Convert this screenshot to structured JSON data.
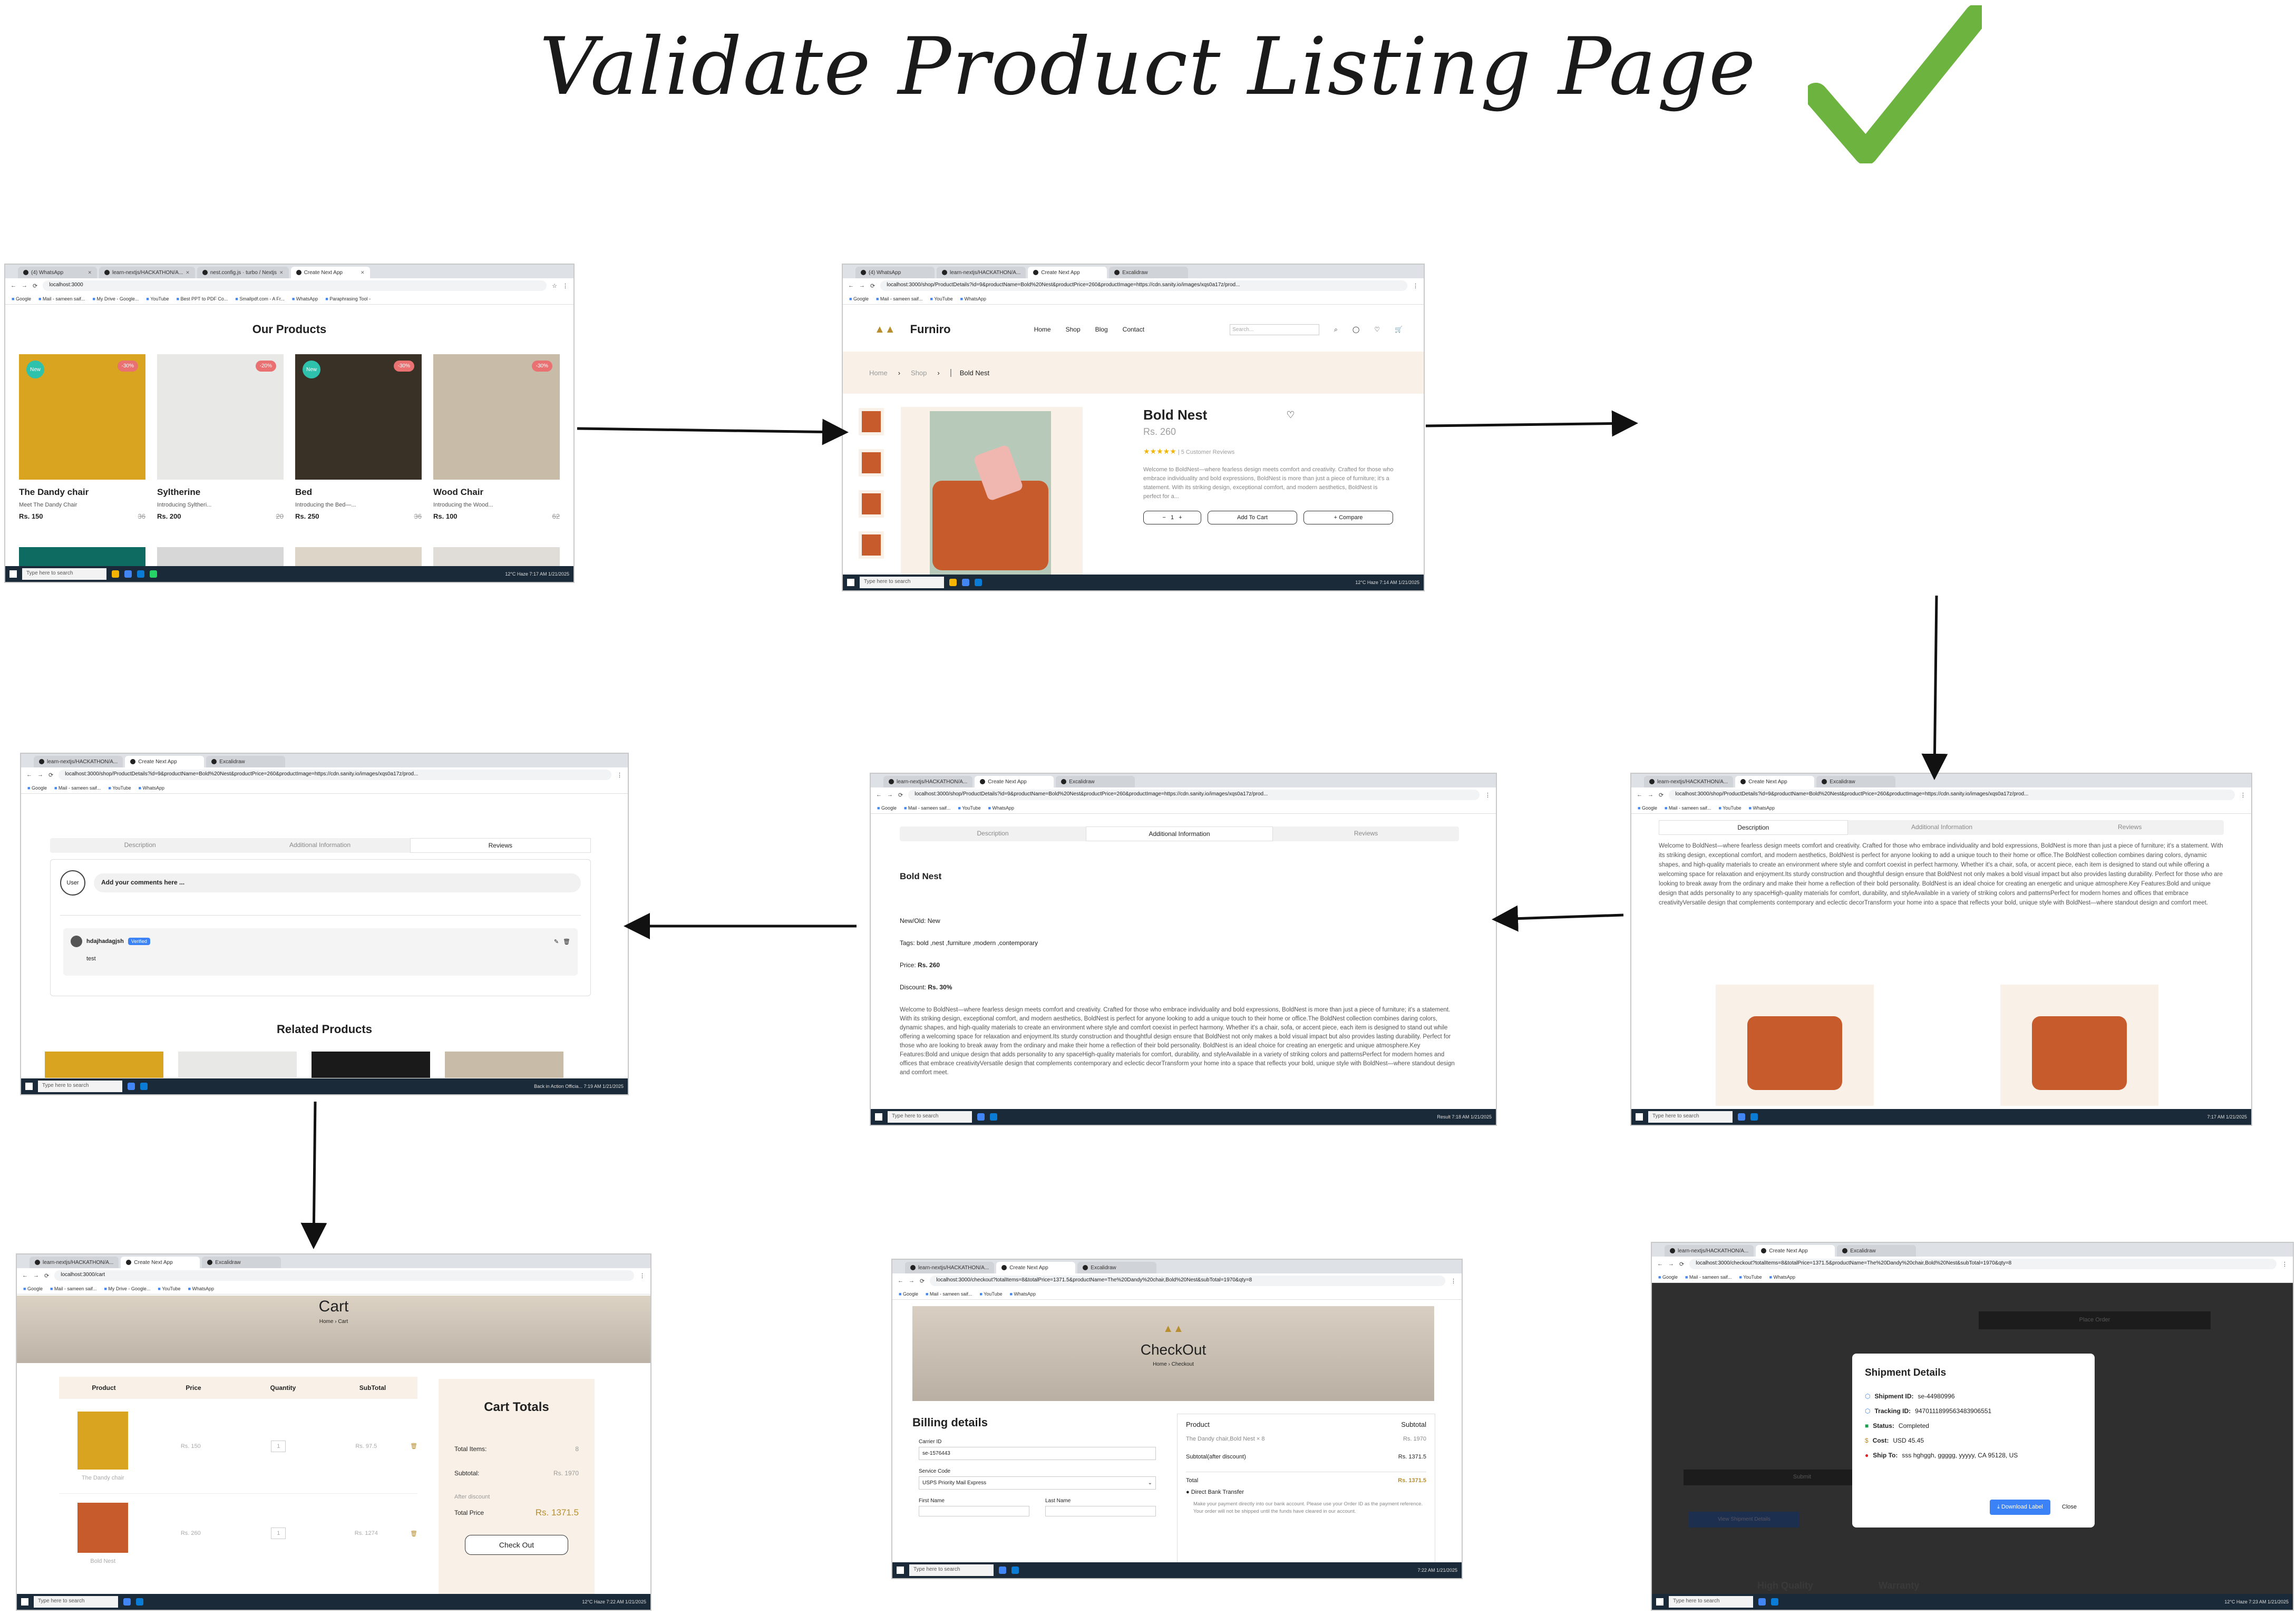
{
  "title": "Validate Product Listing Page",
  "colors": {
    "check": "#6cb33f",
    "gold": "#b88e2f",
    "beige": "#f9f1e7",
    "sofa": "#c75b2c",
    "badge_new": "#2ec1ac",
    "badge_sale": "#e97171",
    "taskbar": "#1b2a38"
  },
  "shot1": {
    "tabs": [
      "(4) WhatsApp",
      "learn-nextjs/HACKATHON/A...",
      "nest.config.js · turbo / Nextjs",
      "Create Next App"
    ],
    "url": "localhost:3000",
    "bookmarks": [
      "Google",
      "Mail - sameen saif...",
      "My Drive - Google...",
      "YouTube",
      "Best PPT to PDF Co...",
      "Smallpdf.com - A Fr...",
      "WhatsApp",
      "Paraphrasing Tool -",
      "All Bookmarks"
    ],
    "heading": "Our Products",
    "products": [
      {
        "name": "The Dandy chair",
        "desc": "Meet The Dandy Chair",
        "price": "Rs. 150",
        "old": "36",
        "badge": "New",
        "badge2": "-30%",
        "color": "#d9a521"
      },
      {
        "name": "Syltherine",
        "desc": "Introducing Syltheri...",
        "price": "Rs. 200",
        "old": "20",
        "badge": "",
        "badge2": "-20%",
        "color": "#e8e8e6"
      },
      {
        "name": "Bed",
        "desc": "Introducing the Bed—...",
        "price": "Rs. 250",
        "old": "36",
        "badge": "New",
        "badge2": "-30%",
        "color": "#3a3126"
      },
      {
        "name": "Wood Chair",
        "desc": "Introducing the Wood...",
        "price": "Rs. 100",
        "old": "62",
        "badge": "",
        "badge2": "-30%",
        "color": "#c8bca8"
      }
    ],
    "taskbar": {
      "search": "Type here to search",
      "tray": "12°C Haze  7:17 AM 1/21/2025"
    }
  },
  "shot2": {
    "tabs": [
      "(4) WhatsApp",
      "learn-nextjs/HACKATHON/A...",
      "Create Next App",
      "Excalidraw"
    ],
    "url": "localhost:3000/shop/ProductDetails?id=9&productName=Bold%20Nest&productPrice=260&productImage=https://cdn.sanity.io/images/xqs0a17z/prod...",
    "brand": "Furniro",
    "nav": [
      "Home",
      "Shop",
      "Blog",
      "Contact"
    ],
    "search": "Search...",
    "crumbs": [
      "Home",
      "Shop",
      "Bold Nest"
    ],
    "name": "Bold Nest",
    "price": "Rs. 260",
    "reviews": "5 Customer Reviews",
    "desc": "Welcome to BoldNest—where fearless design meets comfort and creativity. Crafted for those who embrace individuality and bold expressions, BoldNest is more than just a piece of furniture; it's a statement. With its striking design, exceptional comfort, and modern aesthetics, BoldNest is perfect for a...",
    "qty": "1",
    "add": "Add To Cart",
    "compare": "+ Compare",
    "taskbar": {
      "search": "Type here to search",
      "tray": "12°C Haze  7:14 AM 1/21/2025"
    }
  },
  "shot3": {
    "tabs": [
      "learn-nextjs/HACKATHON/A...",
      "Create Next App",
      "Excalidraw"
    ],
    "url": "localhost:3000/shop/ProductDetails?id=9&productName=Bold%20Nest&productPrice=260&productImage=https://cdn.sanity.io/images/xqs0a17z/prod...",
    "tabs_inner": [
      "Description",
      "Additional Information",
      "Reviews"
    ],
    "text": "Welcome to BoldNest—where fearless design meets comfort and creativity. Crafted for those who embrace individuality and bold expressions, BoldNest is more than just a piece of furniture; it's a statement. With its striking design, exceptional comfort, and modern aesthetics, BoldNest is perfect for anyone looking to add a unique touch to their home or office.The BoldNest collection combines daring colors, dynamic shapes, and high-quality materials to create an environment where style and comfort coexist in perfect harmony. Whether it's a chair, sofa, or accent piece, each item is designed to stand out while offering a welcoming space for relaxation and enjoyment.Its sturdy construction and thoughtful design ensure that BoldNest not only makes a bold visual impact but also provides lasting durability. Perfect for those who are looking to break away from the ordinary and make their home a reflection of their bold personality. BoldNest is an ideal choice for creating an energetic and unique atmosphere.Key Features:Bold and unique design that adds personality to any spaceHigh-quality materials for comfort, durability, and styleAvailable in a variety of striking colors and patternsPerfect for modern homes and offices that embrace creativityVersatile design that complements contemporary and eclectic decorTransform your home into a space that reflects your bold, unique style with BoldNest—where standout design and comfort meet.",
    "taskbar": {
      "search": "Type here to search",
      "tray": "7:17 AM 1/21/2025"
    }
  },
  "shot4": {
    "tabs": [
      "learn-nextjs/HACKATHON/A...",
      "Create Next App",
      "Excalidraw"
    ],
    "url": "localhost:3000/shop/ProductDetails?id=9&productName=Bold%20Nest&productPrice=260&productImage=https://cdn.sanity.io/images/xqs0a17z/prod...",
    "tabs_inner": [
      "Description",
      "Additional Information",
      "Reviews"
    ],
    "name": "Bold Nest",
    "new_label": "New/Old:",
    "new_val": "New",
    "tags_label": "Tags:",
    "tags_val": "bold ,nest ,furniture ,modern ,contemporary",
    "price_label": "Price:",
    "price_val": "Rs. 260",
    "disc_label": "Discount:",
    "disc_val": "Rs. 30%",
    "text": "Welcome to BoldNest—where fearless design meets comfort and creativity. Crafted for those who embrace individuality and bold expressions, BoldNest is more than just a piece of furniture; it's a statement. With its striking design, exceptional comfort, and modern aesthetics, BoldNest is perfect for anyone looking to add a unique touch to their home or office.The BoldNest collection combines daring colors, dynamic shapes, and high-quality materials to create an environment where style and comfort coexist in perfect harmony. Whether it's a chair, sofa, or accent piece, each item is designed to stand out while offering a welcoming space for relaxation and enjoyment.Its sturdy construction and thoughtful design ensure that BoldNest not only makes a bold visual impact but also provides lasting durability. Perfect for those who are looking to break away from the ordinary and make their home a reflection of their bold personality. BoldNest is an ideal choice for creating an energetic and unique atmosphere.Key Features:Bold and unique design that adds personality to any spaceHigh-quality materials for comfort, durability, and styleAvailable in a variety of striking colors and patternsPerfect for modern homes and offices that embrace creativityVersatile design that complements contemporary and eclectic decorTransform your home into a space that reflects your bold, unique style with BoldNest—where standout design and comfort meet.",
    "taskbar": {
      "search": "Type here to search",
      "tray": "Result  7:18 AM 1/21/2025"
    }
  },
  "shot5": {
    "tabs": [
      "learn-nextjs/HACKATHON/A...",
      "Create Next App",
      "Excalidraw"
    ],
    "url": "localhost:3000/shop/ProductDetails?id=9&productName=Bold%20Nest&productPrice=260&productImage=https://cdn.sanity.io/images/xqs0a17z/prod...",
    "tabs_inner": [
      "Description",
      "Additional Information",
      "Reviews"
    ],
    "avatar": "User",
    "comment_placeholder": "Add your comments here ...",
    "reviewer": "hdajhadagjsh",
    "verified": "Verified",
    "review_text": "test",
    "related": "Related Products",
    "taskbar": {
      "search": "Type here to search",
      "tray": "Back in Action Officia...  7:19 AM 1/21/2025"
    }
  },
  "shot6": {
    "tabs": [
      "learn-nextjs/HACKATHON/A...",
      "Create Next App",
      "Excalidraw"
    ],
    "url": "localhost:3000/cart",
    "heading": "Cart",
    "crumbs": [
      "Home",
      "Cart"
    ],
    "cols": [
      "Product",
      "Price",
      "Quantity",
      "SubTotal"
    ],
    "rows": [
      {
        "name": "The Dandy chair",
        "price": "Rs. 150",
        "qty": "1",
        "sub": "Rs. 97.5",
        "color": "#d9a521"
      },
      {
        "name": "Bold Nest",
        "price": "Rs. 260",
        "qty": "1",
        "sub": "Rs. 1274",
        "color": "#c75b2c"
      }
    ],
    "totals_title": "Cart Totals",
    "total_items_label": "Total Items:",
    "total_items": "8",
    "subtotal_label": "Subtotal:",
    "subtotal": "Rs. 1970",
    "after_discount": "After discount",
    "total_label": "Total Price",
    "total": "Rs. 1371.5",
    "checkout": "Check Out",
    "taskbar": {
      "search": "Type here to search",
      "tray": "12°C Haze  7:22 AM 1/21/2025"
    }
  },
  "shot7": {
    "tabs": [
      "learn-nextjs/HACKATHON/A...",
      "Create Next App",
      "Excalidraw"
    ],
    "url": "localhost:3000/checkout?totalItems=8&totalPrice=1371.5&productName=The%20Dandy%20chair,Bold%20Nest&subTotal=1970&qty=8",
    "heading": "CheckOut",
    "crumbs": [
      "Home",
      "Checkout"
    ],
    "billing": "Billing details",
    "carrier_label": "Carrier ID",
    "carrier": "se-1576443",
    "service_label": "Service Code",
    "service": "USPS Priority Mail Express",
    "first": "First Name",
    "last": "Last Name",
    "sum_product": "Product",
    "sum_subtotal": "Subtotal",
    "sum_item": "The Dandy chair,Bold Nest × 8",
    "sum_item_val": "Rs. 1970",
    "sum_after": "Subtotal(after discount)",
    "sum_after_val": "Rs. 1371.5",
    "sum_total": "Total",
    "sum_total_val": "Rs. 1371.5",
    "bank": "Direct Bank Transfer",
    "bank_note": "Make your payment directly into our bank account. Please use your Order ID as the payment reference. Your order will not be shipped until the funds have cleared in our account.",
    "taskbar": {
      "search": "Type here to search",
      "tray": "7:22 AM 1/21/2025"
    }
  },
  "shot8": {
    "tabs": [
      "learn-nextjs/HACKATHON/A...",
      "Create Next App",
      "Excalidraw"
    ],
    "url": "localhost:3000/checkout?totalItems=8&totalPrice=1371.5&productName=The%20Dandy%20chair,Bold%20Nest&subTotal=1970&qty=8",
    "modal_title": "Shipment Details",
    "fields": [
      {
        "label": "Shipment ID:",
        "value": "se-44980996",
        "icon": "package-icon"
      },
      {
        "label": "Tracking ID:",
        "value": "9470111899563483906551",
        "icon": "tracking-icon"
      },
      {
        "label": "Status:",
        "value": "Completed",
        "icon": "truck-icon"
      },
      {
        "label": "Cost:",
        "value": "USD 45.45",
        "icon": "dollar-icon"
      },
      {
        "label": "Ship To:",
        "value": "sss hghggh, ggggg, yyyyy, CA 95128, US",
        "icon": "pin-icon"
      }
    ],
    "download": "Download Label",
    "close": "Close",
    "bg_words": [
      "Place Order",
      "Submit",
      "View Shipment Details",
      "High Quality",
      "Warranty"
    ],
    "taskbar": {
      "search": "Type here to search",
      "tray": "12°C Haze  7:23 AM 1/21/2025"
    }
  }
}
